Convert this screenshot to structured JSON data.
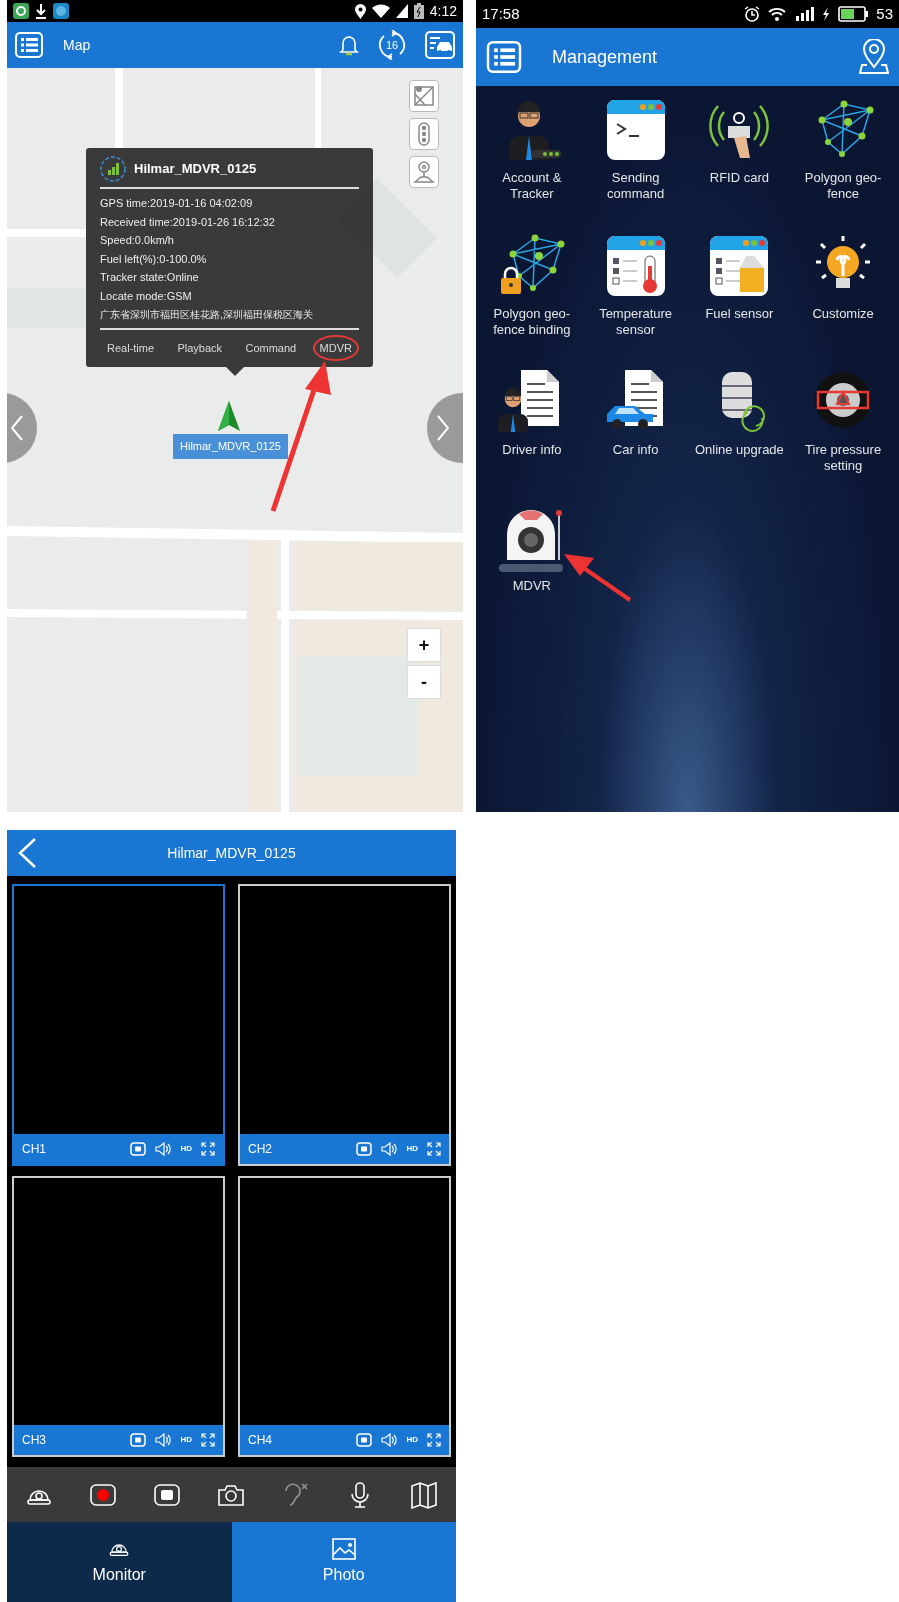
{
  "map_screen": {
    "status_bar": {
      "time": "4:12"
    },
    "title": "Map",
    "refresh_count": "16",
    "popup": {
      "title": "Hilmar_MDVR_0125",
      "lines": [
        "GPS time:2019-01-16 04:02:09",
        "Received time:2019-01-26 16:12:32",
        "Speed:0.0km/h",
        "Fuel left(%):0-100.0%",
        "Tracker state:Online",
        "Locate mode:GSM"
      ],
      "address": "广东省深圳市福田区桂花路,深圳福田保税区海关",
      "actions": [
        {
          "label": "Real-time",
          "highlighted": false
        },
        {
          "label": "Playback",
          "highlighted": false
        },
        {
          "label": "Command",
          "highlighted": false
        },
        {
          "label": "MDVR",
          "highlighted": true
        }
      ]
    },
    "marker_label": "Hilmar_MDVR_0125",
    "zoom_in": "+",
    "zoom_out": "-"
  },
  "management_screen": {
    "status_bar": {
      "time": "17:58",
      "battery": "53"
    },
    "title": "Management",
    "items": [
      {
        "label": "Account & Tracker"
      },
      {
        "label": "Sending command"
      },
      {
        "label": "RFID card"
      },
      {
        "label": "Polygon geo-fence"
      },
      {
        "label": "Polygon geo-fence binding"
      },
      {
        "label": "Temperature sensor"
      },
      {
        "label": "Fuel sensor"
      },
      {
        "label": "Customize"
      },
      {
        "label": "Driver info"
      },
      {
        "label": "Car info"
      },
      {
        "label": "Online upgrade"
      },
      {
        "label": "Tire pressure setting"
      },
      {
        "label": "MDVR"
      }
    ]
  },
  "mdvr_screen": {
    "title": "Hilmar_MDVR_0125",
    "channels": [
      {
        "label": "CH1",
        "selected": true,
        "quality": "HD"
      },
      {
        "label": "CH2",
        "selected": false,
        "quality": "HD"
      },
      {
        "label": "CH3",
        "selected": false,
        "quality": "HD"
      },
      {
        "label": "CH4",
        "selected": false,
        "quality": "HD"
      }
    ],
    "toolbar": [
      {
        "disabled": false
      },
      {
        "disabled": false
      },
      {
        "disabled": false
      },
      {
        "disabled": false
      },
      {
        "disabled": true
      },
      {
        "disabled": false
      },
      {
        "disabled": false
      }
    ],
    "tabs": [
      {
        "label": "Monitor",
        "selected": true
      },
      {
        "label": "Photo",
        "selected": false
      }
    ]
  }
}
